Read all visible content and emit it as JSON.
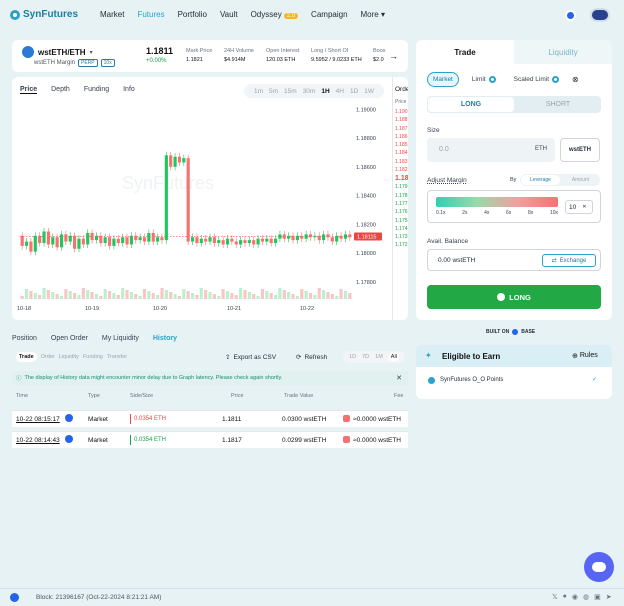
{
  "nav": {
    "logo": "SynFutures",
    "links": [
      "Market",
      "Futures",
      "Portfolio",
      "Vault",
      "Odyssey",
      "Campaign",
      "More"
    ],
    "odyssey_badge": "2.0"
  },
  "pair": {
    "name": "wstETH/ETH",
    "sub": "wstETH Margin",
    "tag1": "PERP",
    "tag2": "10x",
    "price": "1.1811",
    "change": "+0.00%",
    "stats": [
      {
        "label": "Mark Price",
        "value": "1.1821"
      },
      {
        "label": "24H Volume",
        "value": "$4.914M"
      },
      {
        "label": "Open Interest",
        "value": "120.03 ETH"
      },
      {
        "label": "Long / Short OI",
        "value": "9.5952 / 9.0233 ETH"
      },
      {
        "label": "Boos",
        "value": "$2.0"
      }
    ]
  },
  "chart_tabs": [
    "Price",
    "Depth",
    "Funding",
    "Info"
  ],
  "intervals": [
    "1m",
    "5m",
    "15m",
    "30m",
    "1H",
    "4H",
    "1D",
    "1W"
  ],
  "orderbook": {
    "title": "Orde",
    "header": "Price",
    "asks": [
      "1.190",
      "1.188",
      "1.187",
      "1.186",
      "1.185",
      "1.184",
      "1.183",
      "1.182"
    ],
    "mid": "1.18",
    "bids": [
      "1.179",
      "1.178",
      "1.177",
      "1.176",
      "1.175",
      "1.174",
      "1.173",
      "1.172"
    ]
  },
  "chart_data": {
    "type": "candlestick",
    "watermark": "SynFutures",
    "x_ticks": [
      "10-18",
      "10-19",
      "10-20",
      "10-21",
      "10-22"
    ],
    "y_ticks": [
      "1.19000",
      "1.18800",
      "1.18600",
      "1.18400",
      "1.18200",
      "1.18000",
      "1.17800"
    ],
    "ylim": [
      1.1775,
      1.1903
    ],
    "last_price": "1.18115",
    "last_price_value": 1.18115,
    "candles": [
      [
        1.1812,
        1.1805
      ],
      [
        1.1805,
        1.1808
      ],
      [
        1.1808,
        1.1801
      ],
      [
        1.1801,
        1.1812
      ],
      [
        1.1812,
        1.1807
      ],
      [
        1.1807,
        1.1815
      ],
      [
        1.1815,
        1.1806
      ],
      [
        1.1806,
        1.1811
      ],
      [
        1.1811,
        1.1804
      ],
      [
        1.1804,
        1.1813
      ],
      [
        1.1813,
        1.1808
      ],
      [
        1.1808,
        1.1812
      ],
      [
        1.1812,
        1.1803
      ],
      [
        1.1803,
        1.181
      ],
      [
        1.181,
        1.1806
      ],
      [
        1.1806,
        1.1814
      ],
      [
        1.1814,
        1.1809
      ],
      [
        1.1809,
        1.1812
      ],
      [
        1.1812,
        1.1807
      ],
      [
        1.1807,
        1.1811
      ],
      [
        1.1811,
        1.1805
      ],
      [
        1.1805,
        1.181
      ],
      [
        1.181,
        1.1807
      ],
      [
        1.1807,
        1.1811
      ],
      [
        1.1811,
        1.1806
      ],
      [
        1.1806,
        1.1812
      ],
      [
        1.1812,
        1.1809
      ],
      [
        1.1809,
        1.1811
      ],
      [
        1.1811,
        1.1808
      ],
      [
        1.1808,
        1.1814
      ],
      [
        1.1814,
        1.1808
      ],
      [
        1.1808,
        1.1811
      ],
      [
        1.1811,
        1.1809
      ],
      [
        1.1809,
        1.1868
      ],
      [
        1.1868,
        1.186
      ],
      [
        1.186,
        1.1867
      ],
      [
        1.1867,
        1.1863
      ],
      [
        1.1863,
        1.1866
      ],
      [
        1.1866,
        1.1808
      ],
      [
        1.1808,
        1.1811
      ],
      [
        1.1811,
        1.1807
      ],
      [
        1.1807,
        1.181
      ],
      [
        1.181,
        1.1808
      ],
      [
        1.1808,
        1.1811
      ],
      [
        1.1811,
        1.1807
      ],
      [
        1.1807,
        1.1809
      ],
      [
        1.1809,
        1.1806
      ],
      [
        1.1806,
        1.181
      ],
      [
        1.181,
        1.1808
      ],
      [
        1.1808,
        1.1806
      ],
      [
        1.1806,
        1.1809
      ],
      [
        1.1809,
        1.1807
      ],
      [
        1.1807,
        1.1809
      ],
      [
        1.1809,
        1.1806
      ],
      [
        1.1806,
        1.181
      ],
      [
        1.181,
        1.1808
      ],
      [
        1.1808,
        1.181
      ],
      [
        1.181,
        1.1807
      ],
      [
        1.1807,
        1.181
      ],
      [
        1.181,
        1.1813
      ],
      [
        1.1813,
        1.181
      ],
      [
        1.181,
        1.1812
      ],
      [
        1.1812,
        1.1809
      ],
      [
        1.1809,
        1.1812
      ],
      [
        1.1812,
        1.181
      ],
      [
        1.181,
        1.1813
      ],
      [
        1.1813,
        1.1811
      ],
      [
        1.1811,
        1.1812
      ],
      [
        1.1812,
        1.1809
      ],
      [
        1.1809,
        1.1813
      ],
      [
        1.1813,
        1.1811
      ],
      [
        1.1811,
        1.1808
      ],
      [
        1.1808,
        1.1812
      ],
      [
        1.1812,
        1.181
      ],
      [
        1.181,
        1.1813
      ],
      [
        1.1813,
        1.1811
      ]
    ]
  },
  "bottom": {
    "tabs": [
      "Position",
      "Open Order",
      "My Liquidity",
      "History"
    ],
    "subtabs": [
      "Trade",
      "Order",
      "Liquidity",
      "Funding",
      "Transfer"
    ],
    "export": "Export as CSV",
    "refresh": "Refresh",
    "ranges": [
      "1D",
      "7D",
      "1M",
      "All"
    ],
    "notice": "The display of History data might encounter minor delay due to Graph latency. Please check again shortly.",
    "headers": [
      "Time",
      "Type",
      "Side/Size",
      "Price",
      "Trade Value",
      "Fee"
    ],
    "rows": [
      {
        "time": "10-22 08:15:17",
        "type": "Market",
        "side": "0.0354 ETH",
        "side_color": "#ef4444",
        "price": "1.1811",
        "value": "0.0300 wstETH",
        "fee": "≈0.0000 wstETH"
      },
      {
        "time": "10-22 08:14:43",
        "type": "Market",
        "side": "0.0354 ETH",
        "side_color": "#16a34a",
        "price": "1.1817",
        "value": "0.0299 wstETH",
        "fee": "≈0.0000 wstETH"
      }
    ]
  },
  "trade": {
    "tabs": [
      "Trade",
      "Liquidity"
    ],
    "order_types": [
      "Market",
      "Limit",
      "Scaled Limit"
    ],
    "long": "LONG",
    "short": "SHORT",
    "size_label": "Size",
    "size_placeholder": "0.0",
    "size_unit": "ETH",
    "size_token": "wstETH",
    "margin_label": "Adjust Margin",
    "by": "By",
    "leverage": "Leverage",
    "amount": "Amount",
    "lev_ticks": [
      "0.1x",
      "2x",
      "4x",
      "6x",
      "8x",
      "10x"
    ],
    "lev_value": "10",
    "balance_label": "Avail. Balance",
    "balance_value": "0.00 wstETH",
    "exchange": "Exchange",
    "long_button": "LONG",
    "built_on": "BUILT ON",
    "base": "BASE"
  },
  "earn": {
    "title": "Eligible to Earn",
    "rules": "Rules",
    "item": "SynFutures O_O Points"
  },
  "footer": {
    "block": "Block: 21396167 (Oct-22-2024 8:21:21 AM)"
  }
}
